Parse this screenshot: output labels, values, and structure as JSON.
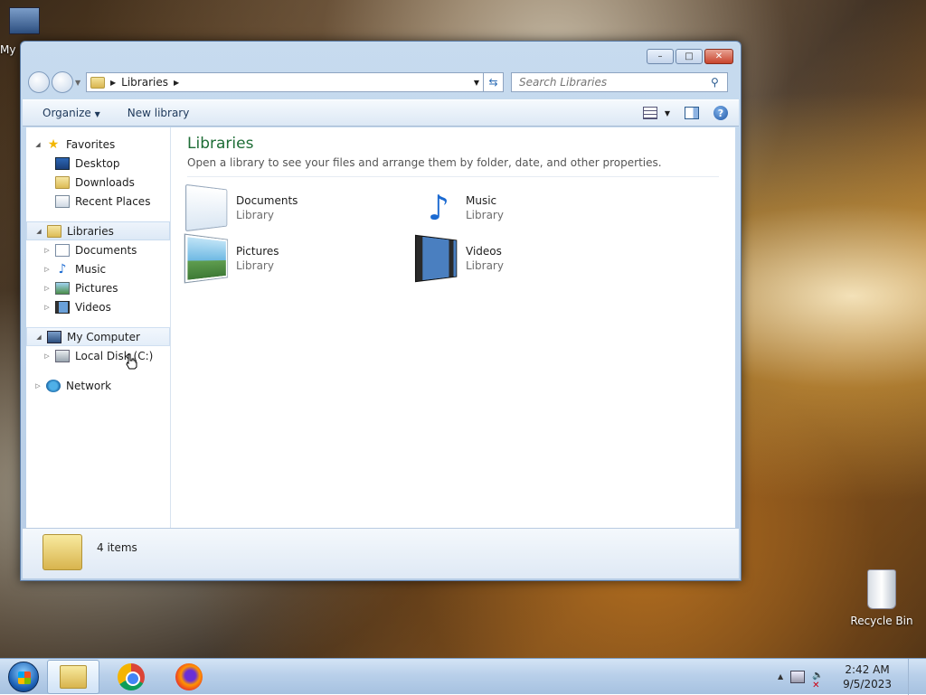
{
  "desktop": {
    "icons": [
      {
        "label": "My"
      },
      {
        "label": "Recycle Bin"
      }
    ]
  },
  "window": {
    "controls": {
      "minimize": "–",
      "maximize": "□",
      "close": "✕"
    },
    "address": {
      "location": "Libraries"
    },
    "search": {
      "placeholder": "Search Libraries"
    },
    "toolbar": {
      "organize": "Organize",
      "new_library": "New library"
    },
    "nav": {
      "favorites": "Favorites",
      "favorites_items": [
        "Desktop",
        "Downloads",
        "Recent Places"
      ],
      "libraries": "Libraries",
      "libraries_items": [
        "Documents",
        "Music",
        "Pictures",
        "Videos"
      ],
      "my_computer": "My Computer",
      "computer_items": [
        "Local Disk (C:)"
      ],
      "network": "Network"
    },
    "content": {
      "title": "Libraries",
      "subtitle": "Open a library to see your files and arrange them by folder, date, and other properties.",
      "items": [
        {
          "name": "Documents",
          "type": "Library"
        },
        {
          "name": "Music",
          "type": "Library"
        },
        {
          "name": "Pictures",
          "type": "Library"
        },
        {
          "name": "Videos",
          "type": "Library"
        }
      ]
    },
    "details": {
      "count": "4 items"
    }
  },
  "taskbar": {
    "time": "2:42 AM",
    "date": "9/5/2023"
  }
}
